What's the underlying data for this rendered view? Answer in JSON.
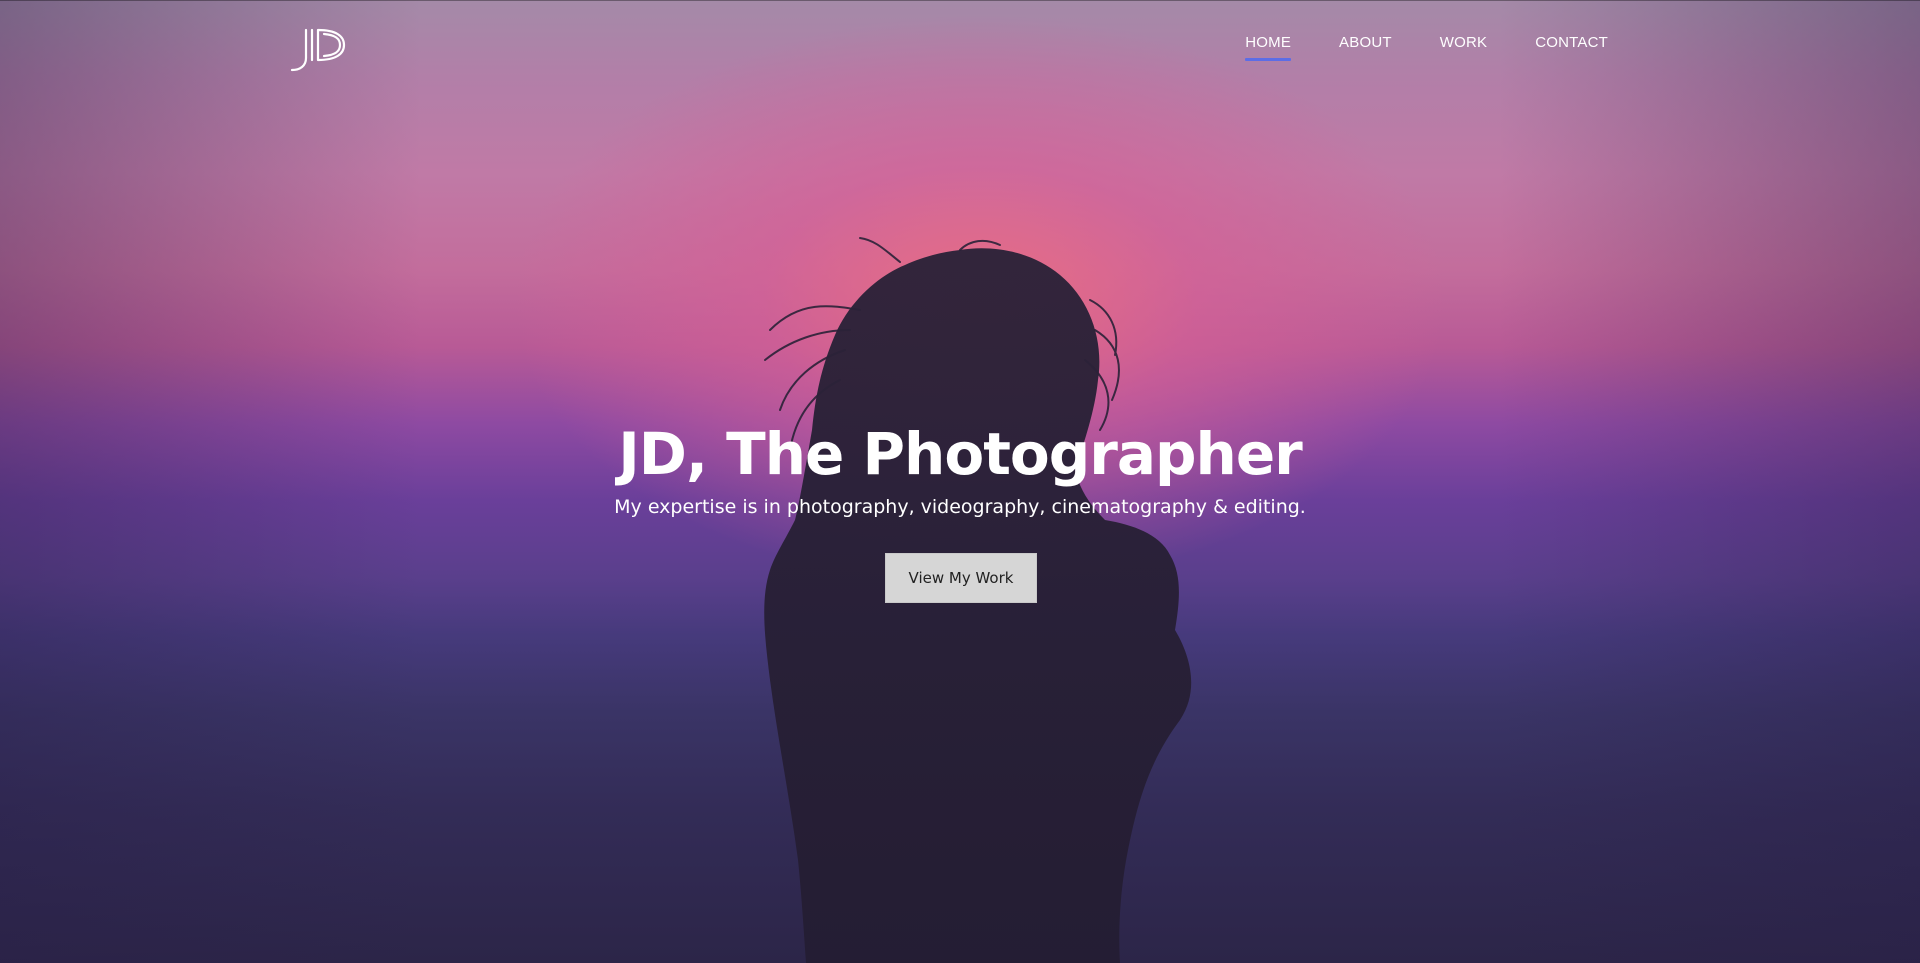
{
  "brand": {
    "logo_text": "JD"
  },
  "nav": {
    "items": [
      {
        "label": "HOME",
        "active": true
      },
      {
        "label": "ABOUT",
        "active": false
      },
      {
        "label": "WORK",
        "active": false
      },
      {
        "label": "CONTACT",
        "active": false
      }
    ],
    "active_underline_color": "#5c6de6"
  },
  "hero": {
    "title": "JD, The Photographer",
    "subtitle": "My expertise is in photography, videography, cinematography & editing.",
    "cta_label": "View My Work"
  },
  "colors": {
    "text": "#ffffff",
    "cta_background": "#d6d6d6",
    "cta_text": "#222222"
  }
}
